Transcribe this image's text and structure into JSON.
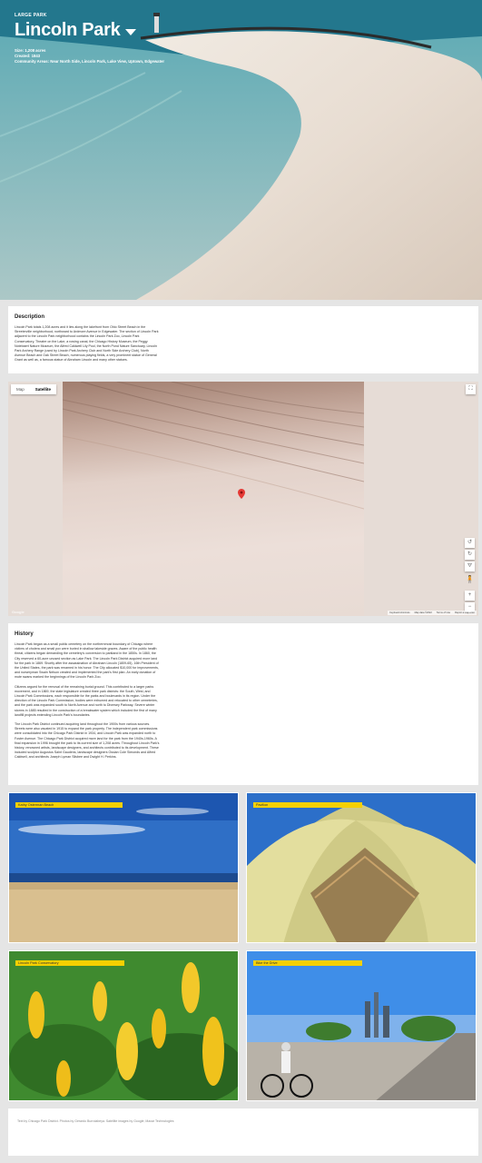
{
  "hero": {
    "type": "Large Park",
    "title": "Lincoln Park",
    "size": "Size: 1,208 acres",
    "created": "Created: 1843",
    "community_areas": "Community Areas: Near North Side, Lincoln Park, Lake View, Uptown, Edgewater"
  },
  "description": {
    "heading": "Description",
    "body": "Lincoln Park totals 1,208 acres and it lies along the lakefront from Ohio Street Beach in the Streeterville neighborhood, northward to Ardmore Avenue in Edgewater. The section of Lincoln Park adjacent to the Lincoln Park neighborhood contains the Lincoln Park Zoo, Lincoln Park Conservatory, Theatre on the Lake, a rowing canal, the Chicago History Museum, the Peggy Notebaert Nature Museum, the Alfred Caldwell Lily Pool, the North Pond Nature Sanctuary, Lincoln Park Archery Range (used by Lincoln Park Archery Club and North Side Archery Club), North Avenue Beach and Oak Street Beach, numerous playing fields, a very prominent statue of General Grant as well as, a famous statue of Abraham Lincoln and many other statues."
  },
  "map": {
    "tab_map": "Map",
    "tab_satellite": "Satellite",
    "fullscreen_glyph": "⛶",
    "rotate_left_glyph": "↺",
    "rotate_right_glyph": "↻",
    "tilt_glyph": "⛛",
    "pegman_glyph": "🧍",
    "zoom_in": "+",
    "zoom_out": "−",
    "google": "Google",
    "shortcuts": "Keyboard shortcuts",
    "map_data": "Map data ©2022",
    "terms": "Terms of Use",
    "report": "Report a map error",
    "marker_color": "#e53935"
  },
  "history": {
    "heading": "History",
    "p1": "Lincoln Park began as a small public cemetery on the northernmost boundary of Chicago where victims of cholera and small pox were buried in shallow lakeside graves. Aware of the public health threat, citizens began demanding the cemetery's conversion to parkland in the 1850s. In 1860, the City reserved a 60-acre unused section as Lake Park. The Lincoln Park District acquired more land for the park in 1869. Shortly after the assassination of Abraham Lincoln (1809-65), 16th President of the United States, the park was renamed in his honor. The City allocated $10,000 for improvements, and nurseryman Swain Nelson created and implemented the park's first plan. An early donation of mute swans marked the beginnings of the Lincoln Park Zoo.",
    "p2": "Citizens argued for the removal of the remaining burial ground. This contributed to a larger parks movement, and in 1869, the state legislature created three park districts: the South, West, and Lincoln Park Commissions, each responsible for the parks and boulevards in its region. Under the direction of the Lincoln Park Commission, bodies were exhumed and relocated to other cemeteries, and the park was expanded south to North Avenue and north to Diversey Parkway. Severe winter storms in 1885 resulted in the construction of a breakwater system which included the first of many landfill projects extending Lincoln Park's boundaries.",
    "p3": "The Lincoln Park District continued acquiring land throughout the 1900s from various sources. Streets were also vacated in 1915 to expand the park property. The independent park commissions were consolidated into the Chicago Park District in 1934, and Lincoln Park was expanded north to Foster Avenue. The Chicago Park District acquired more land for the park from the 1940s-1960s. A final expansion in 1996 brought the park to its current size of 1,208 acres. Throughout Lincoln Park's history, renowned artists, landscape designers, and architects contributed to its development. These included sculptor Augustus Saint Gaudens, landscape designers Ossian Cole Simonds and Alfred Caldwell, and architects Joseph Lyman Silsbee and Dwight H. Perkins."
  },
  "photos": [
    {
      "label": "Kathy Osterman Beach"
    },
    {
      "label": "Pavilion"
    },
    {
      "label": "Lincoln Park Conservatory"
    },
    {
      "label": "Bike the Drive"
    }
  ],
  "footer": {
    "credits": "Text by Chicago Park District. Photos by Gerardo Burrolabeya. Satellite images by Google; Maxar Technologies"
  },
  "colors": {
    "accent_label": "#f5d000",
    "lake": "#2d8ba0",
    "sand": "#e6dad0"
  }
}
